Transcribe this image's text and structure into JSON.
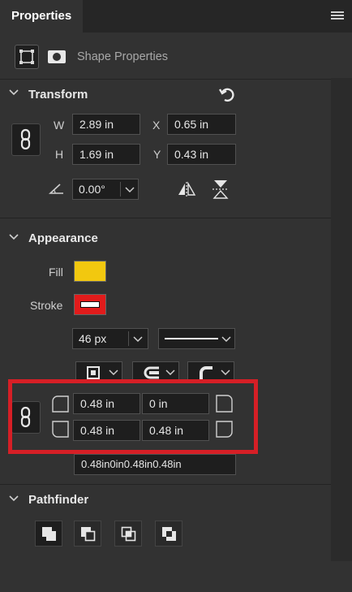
{
  "header": {
    "tab_label": "Properties",
    "menu_icon": "hamburger-menu-icon"
  },
  "mode": {
    "label": "Shape Properties",
    "buttons": [
      {
        "name": "bounding-box-icon",
        "active": true
      },
      {
        "name": "mask-icon",
        "active": false
      }
    ]
  },
  "transform": {
    "title": "Transform",
    "reset_icon": "reset-icon",
    "link_icon": "link-icon",
    "w_label": "W",
    "w_value": "2.89 in",
    "h_label": "H",
    "h_value": "1.69 in",
    "x_label": "X",
    "x_value": "0.65 in",
    "y_label": "Y",
    "y_value": "0.43 in",
    "angle_value": "0.00°",
    "flip_h_icon": "flip-horizontal-icon",
    "flip_v_icon": "flip-vertical-icon"
  },
  "appearance": {
    "title": "Appearance",
    "fill_label": "Fill",
    "fill_color": "#f2c80f",
    "stroke_label": "Stroke",
    "stroke_color": "#e11b1b",
    "stroke_width": "46 px",
    "corners": {
      "top_left": "0.48 in",
      "top_right": "0 in",
      "bottom_left": "0.48 in",
      "bottom_right": "0.48 in",
      "combined": "0.48in0in0.48in0.48in"
    },
    "highlight_color": "#d61f26"
  },
  "pathfinder": {
    "title": "Pathfinder",
    "buttons": [
      {
        "name": "unite-icon",
        "active": true
      },
      {
        "name": "subtract-icon",
        "active": false
      },
      {
        "name": "intersect-icon",
        "active": false
      },
      {
        "name": "exclude-icon",
        "active": false
      }
    ]
  }
}
